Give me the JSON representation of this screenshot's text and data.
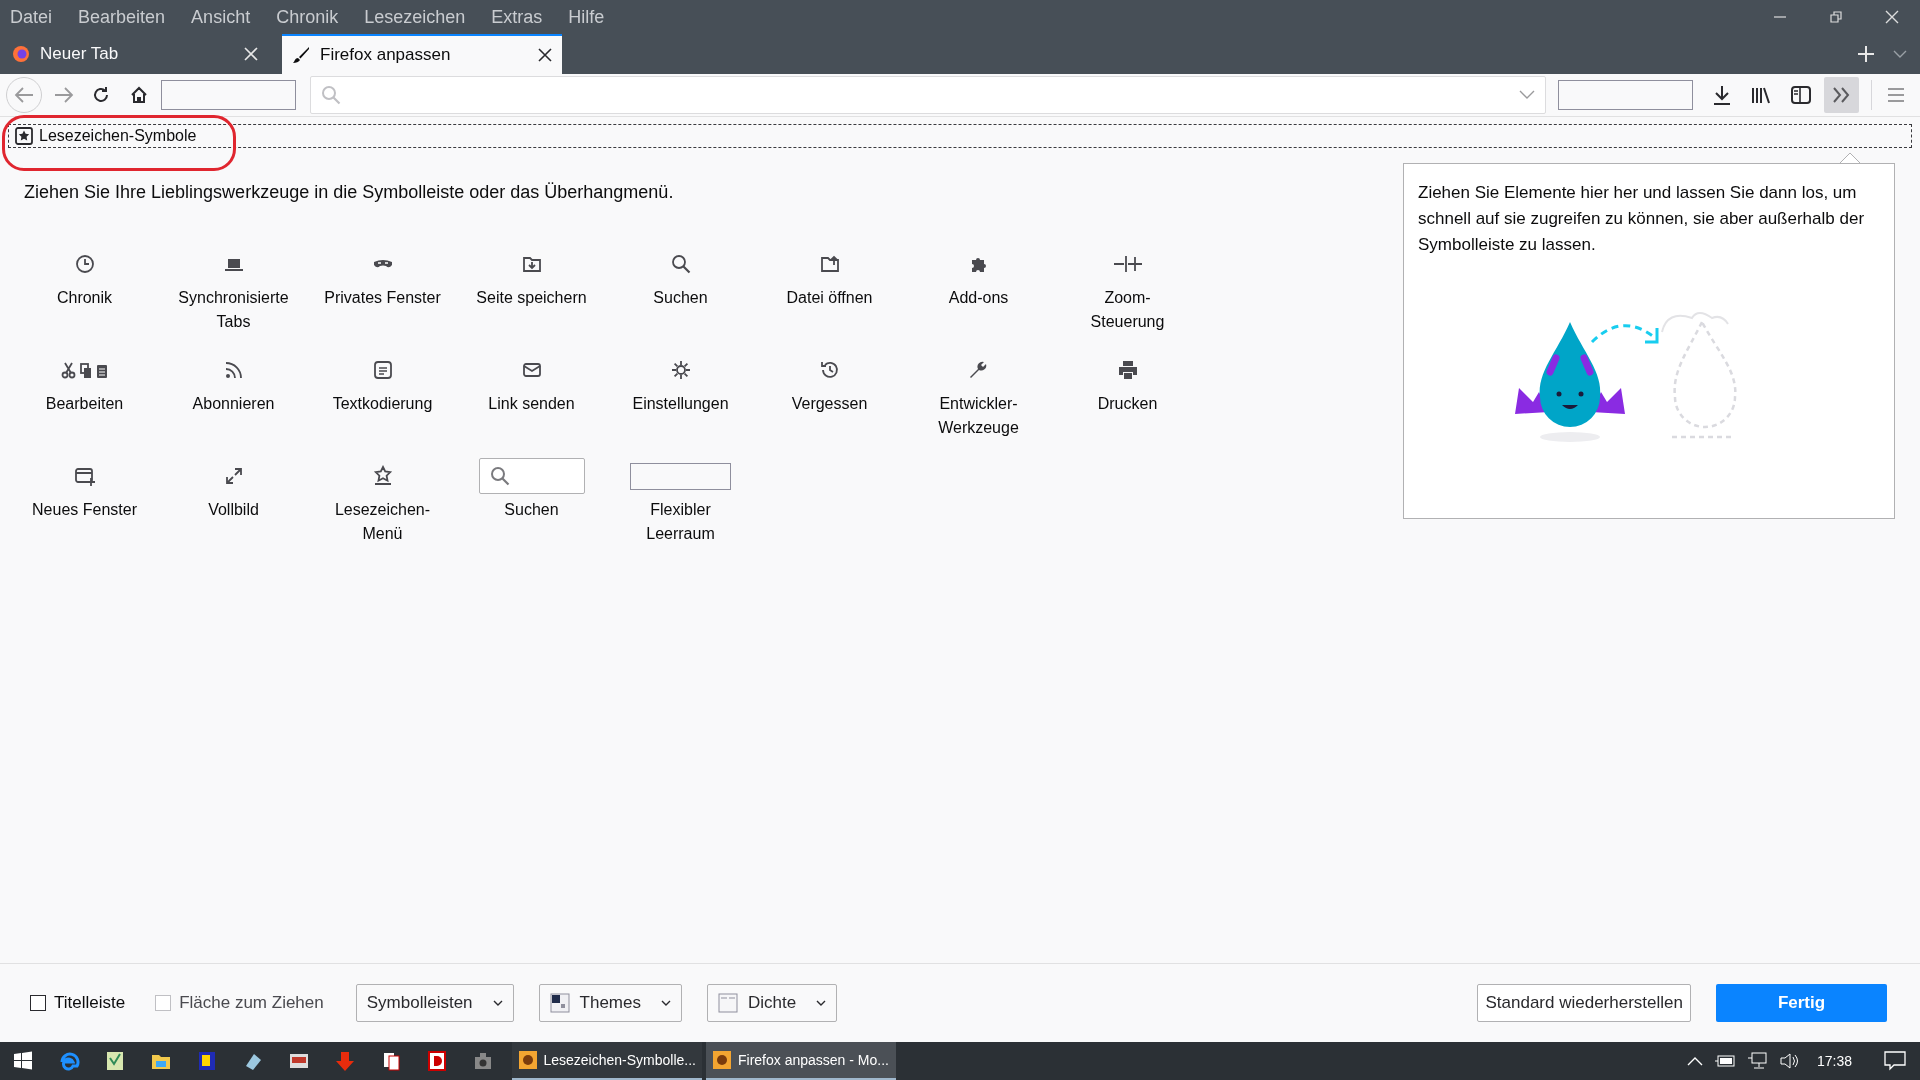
{
  "menu_bar": [
    "Datei",
    "Bearbeiten",
    "Ansicht",
    "Chronik",
    "Lesezeichen",
    "Extras",
    "Hilfe"
  ],
  "tabs": [
    {
      "label": "Neuer Tab",
      "selected": false
    },
    {
      "label": "Firefox anpassen",
      "selected": true
    }
  ],
  "bookmarks_toolbar": {
    "label": "Lesezeichen-Symbole"
  },
  "palette": {
    "intro": "Ziehen Sie Ihre Lieblingswerkzeuge in die Symbolleiste oder das Überhangmenü.",
    "items": [
      {
        "kind": "button",
        "label": "Chronik"
      },
      {
        "kind": "button",
        "label": "Synchronisierte Tabs"
      },
      {
        "kind": "button",
        "label": "Privates Fenster"
      },
      {
        "kind": "button",
        "label": "Seite speichern"
      },
      {
        "kind": "button",
        "label": "Suchen"
      },
      {
        "kind": "button",
        "label": "Datei öffnen"
      },
      {
        "kind": "button",
        "label": "Add-ons"
      },
      {
        "kind": "button",
        "label": "Zoom-Steuerung"
      },
      {
        "kind": "button",
        "label": "Bearbeiten"
      },
      {
        "kind": "button",
        "label": "Abonnieren"
      },
      {
        "kind": "button",
        "label": "Textkodierung"
      },
      {
        "kind": "button",
        "label": "Link senden"
      },
      {
        "kind": "button",
        "label": "Einstellungen"
      },
      {
        "kind": "button",
        "label": "Vergessen"
      },
      {
        "kind": "button",
        "label": "Entwickler-Werkzeuge"
      },
      {
        "kind": "button",
        "label": "Drucken"
      },
      {
        "kind": "button",
        "label": "Neues Fenster"
      },
      {
        "kind": "button",
        "label": "Vollbild"
      },
      {
        "kind": "button",
        "label": "Lesezeichen-Menü"
      },
      {
        "kind": "search",
        "label": "Suchen"
      },
      {
        "kind": "spacer",
        "label": "Flexibler Leerraum"
      }
    ]
  },
  "overflow_panel": {
    "text": "Ziehen Sie Elemente hier her und lassen Sie dann los, um schnell auf sie zugreifen zu können, sie aber außerhalb der Symbolleiste zu lassen."
  },
  "footer": {
    "checkboxes": [
      {
        "label": "Titelleiste",
        "checked": false,
        "disabled": false
      },
      {
        "label": "Fläche zum Ziehen",
        "checked": false,
        "disabled": true
      }
    ],
    "dropdowns": [
      {
        "label": "Symbolleisten",
        "kind": "plain"
      },
      {
        "label": "Themes",
        "kind": "theme"
      },
      {
        "label": "Dichte",
        "kind": "density"
      }
    ],
    "buttons": [
      {
        "label": "Standard wiederherstellen",
        "kind": "secondary"
      },
      {
        "label": "Fertig",
        "kind": "primary"
      }
    ]
  },
  "taskbar": {
    "windows": [
      {
        "label": "Lesezeichen-Symbolle...",
        "selected": false
      },
      {
        "label": "Firefox anpassen - Mo...",
        "selected": true
      }
    ],
    "clock": "17:38"
  }
}
